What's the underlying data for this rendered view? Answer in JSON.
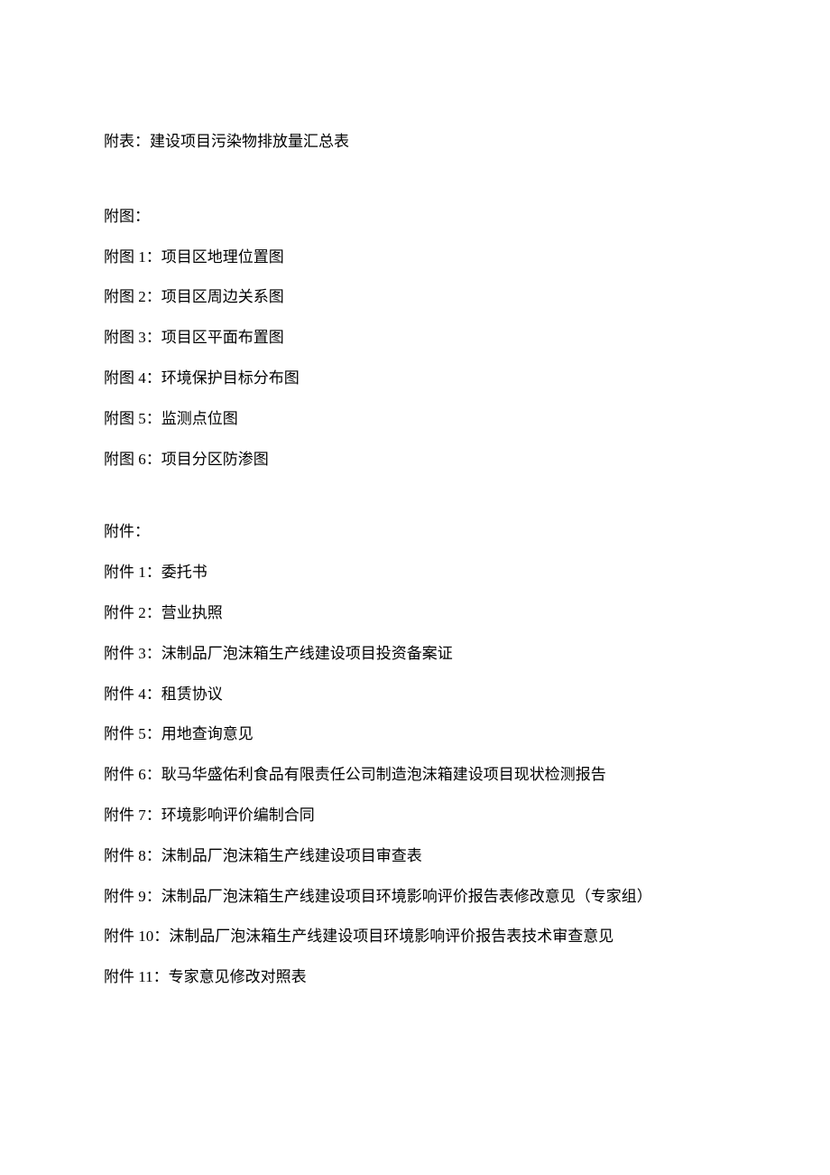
{
  "attachment_table_heading": "附表：建设项目污染物排放量汇总表",
  "figures_heading": "附图：",
  "figures": [
    "附图 1：项目区地理位置图",
    "附图 2：项目区周边关系图",
    "附图 3：项目区平面布置图",
    "附图 4：环境保护目标分布图",
    "附图 5：监测点位图",
    "附图 6：项目分区防渗图"
  ],
  "attachments_heading": "附件：",
  "attachments": [
    "附件 1：委托书",
    "附件 2：营业执照",
    "附件 3：沫制品厂泡沫箱生产线建设项目投资备案证",
    "附件 4：租赁协议",
    "附件 5：用地查询意见",
    "附件 6：耿马华盛佑利食品有限责任公司制造泡沫箱建设项目现状检测报告",
    "附件 7：环境影响评价编制合同",
    "附件 8：沫制品厂泡沫箱生产线建设项目审查表",
    "附件 9：沫制品厂泡沫箱生产线建设项目环境影响评价报告表修改意见（专家组）",
    "附件 10：沫制品厂泡沫箱生产线建设项目环境影响评价报告表技术审查意见",
    "附件 11：专家意见修改对照表"
  ]
}
